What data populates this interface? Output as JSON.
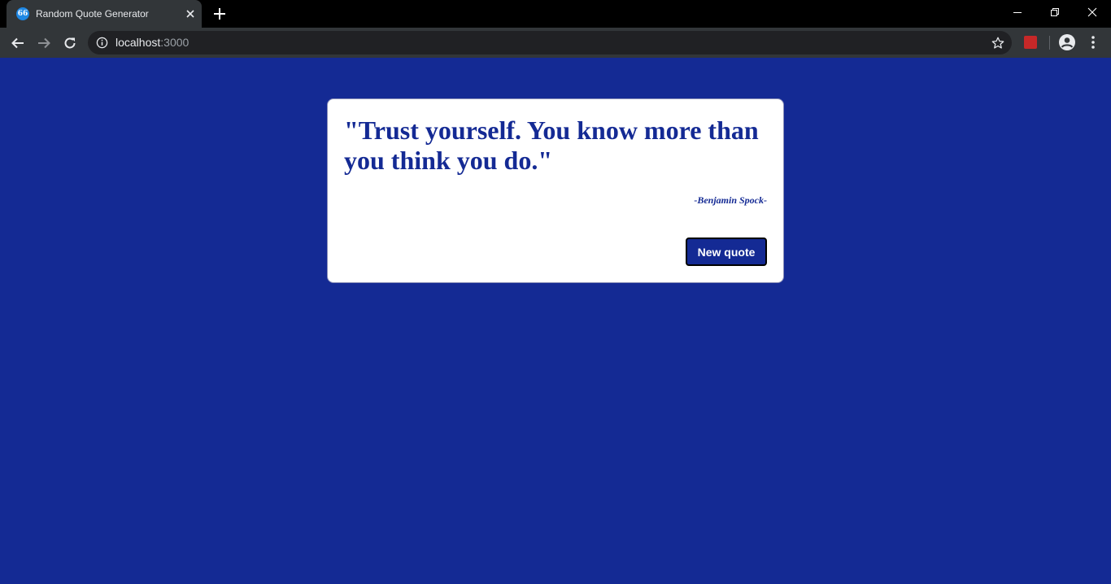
{
  "browser": {
    "tab_title": "Random Quote Generator",
    "tab_favicon_glyph": "66",
    "url_host": "localhost",
    "url_port": ":3000",
    "icons": {
      "back": "arrow-left-icon",
      "forward": "arrow-right-icon",
      "reload": "reload-icon",
      "info": "info-icon",
      "star": "star-icon",
      "extension": "extension-icon",
      "profile": "account-circle-icon",
      "menu": "kebab-menu-icon",
      "minimize": "minimize-icon",
      "restore": "restore-icon",
      "close": "close-icon",
      "new_tab": "plus-icon"
    }
  },
  "quote": {
    "text": "\"Trust yourself. You know more than you think you do.\"",
    "author": "-Benjamin Spock-"
  },
  "actions": {
    "new_quote_label": "New quote"
  },
  "colors": {
    "page_background": "#142a94",
    "accent": "#142a94",
    "card_background": "#ffffff",
    "chrome_dark": "#000000",
    "chrome_toolbar": "#323639"
  }
}
